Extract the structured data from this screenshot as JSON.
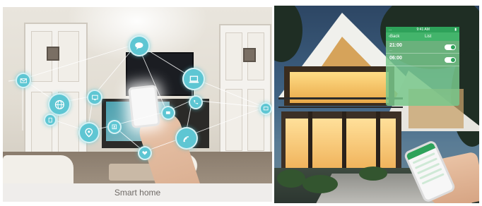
{
  "left_panel": {
    "caption": "Smart home",
    "node_icons": [
      "email-icon",
      "message-bubble-icon",
      "laptop-icon",
      "globe-icon",
      "monitor-icon",
      "location-pin-icon",
      "phone-icon",
      "wifi-icon",
      "tablet-icon",
      "heart-icon",
      "screen-icon",
      "contact-card-icon",
      "monitor-icon"
    ],
    "colors": {
      "node": "#5ec6d3",
      "caption_bar": "#efedeb",
      "caption_text": "#6f6a66"
    }
  },
  "right_panel": {
    "app": {
      "status_left": "...",
      "status_center": "9:41 AM",
      "back_label": "Back",
      "title": "List",
      "rows": [
        {
          "time": "21:00",
          "desc": "...",
          "toggle": "on"
        },
        {
          "time": "06:00",
          "desc": "...",
          "toggle": "on"
        }
      ]
    },
    "colors": {
      "app_green": "#43b46b",
      "window_glow": "#ffdc86",
      "sky": "#2d4664"
    }
  }
}
